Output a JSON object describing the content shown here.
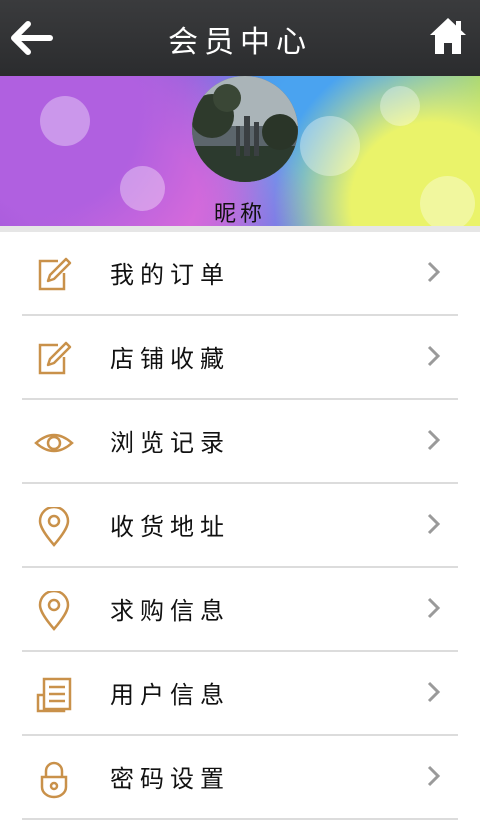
{
  "header": {
    "title": "会员中心",
    "back_icon": "back-arrow-icon",
    "home_icon": "home-icon"
  },
  "profile": {
    "nickname": "昵称"
  },
  "menu": {
    "items": [
      {
        "label": "我的订单",
        "icon": "edit-icon"
      },
      {
        "label": "店铺收藏",
        "icon": "edit-icon"
      },
      {
        "label": "浏览记录",
        "icon": "eye-icon"
      },
      {
        "label": "收货地址",
        "icon": "location-pin-icon"
      },
      {
        "label": "求购信息",
        "icon": "location-pin-icon"
      },
      {
        "label": "用户信息",
        "icon": "document-icon"
      },
      {
        "label": "密码设置",
        "icon": "lock-icon"
      }
    ]
  },
  "colors": {
    "accent": "#c9914a",
    "header": "#2f3032"
  }
}
